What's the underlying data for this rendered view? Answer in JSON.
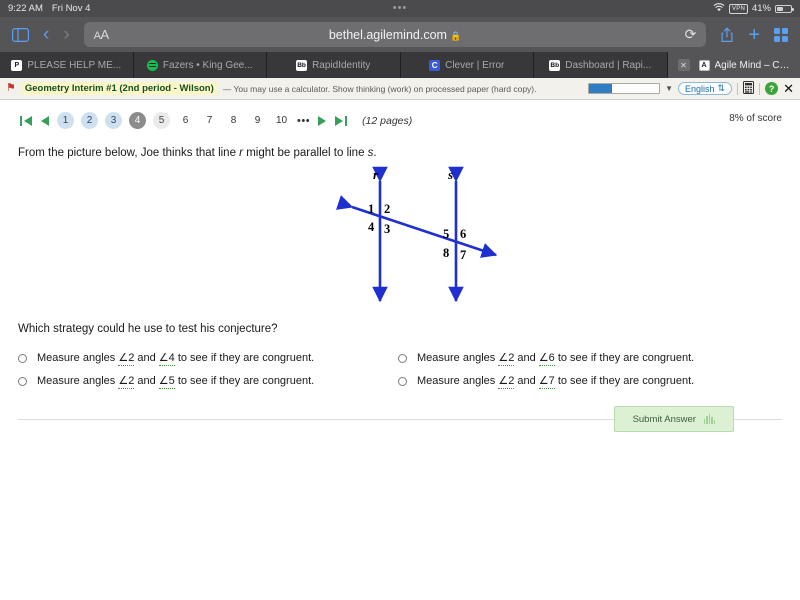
{
  "status_bar": {
    "time": "9:22 AM",
    "date": "Fri Nov 4",
    "dots": "•••",
    "wifi_icon": "wifi-icon",
    "vpn_label": "VPN",
    "battery_percent": "41%"
  },
  "browser": {
    "sidebar_icon": "sidebar-icon",
    "back_icon": "chevron-left-icon",
    "forward_icon": "chevron-right-icon",
    "text_size_label": "AA",
    "url": "bethel.agilemind.com",
    "lock_icon": "lock-icon",
    "reload_icon": "reload-icon",
    "share_icon": "share-icon",
    "new_tab_icon": "plus-icon",
    "show_tabs_icon": "tabs-grid-icon",
    "tabs": [
      {
        "title": "PLEASE HELP ME...",
        "favicon": "powerpoint-icon",
        "favicon_letter": "P",
        "active": false
      },
      {
        "title": "Fazers • King Gee...",
        "favicon": "spotify-icon",
        "favicon_letter": "",
        "active": false
      },
      {
        "title": "RapidIdentity",
        "favicon": "blackboard-icon",
        "favicon_letter": "Bb",
        "active": false
      },
      {
        "title": "Clever | Error",
        "favicon": "clever-icon",
        "favicon_letter": "C",
        "active": false
      },
      {
        "title": "Dashboard | Rapi...",
        "favicon": "blackboard-icon",
        "favicon_letter": "Bb",
        "active": false
      },
      {
        "title": "Agile Mind – Cour...",
        "favicon": "agilemind-icon",
        "favicon_letter": "A",
        "active": true,
        "close_label": "✕"
      }
    ]
  },
  "app_header": {
    "flag_icon": "flag-icon",
    "assignment_title": "Geometry Interim #1 (2nd period - Wilson)",
    "assignment_note": "— You may use a calculator. Show thinking (work) on processed paper (hard copy).",
    "progress_percent": 33,
    "progress_caret_icon": "chevron-down-icon",
    "language": "English",
    "language_caret_icon": "select-chevron-icon",
    "calculator_icon": "calculator-icon",
    "help_icon": "help-icon",
    "help_label": "?",
    "close_icon": "close-icon"
  },
  "pager": {
    "first_icon": "first-page-icon",
    "prev_icon": "previous-page-icon",
    "pages": [
      {
        "label": "1",
        "state": "visited"
      },
      {
        "label": "2",
        "state": "visited"
      },
      {
        "label": "3",
        "state": "visited"
      },
      {
        "label": "4",
        "state": "current"
      },
      {
        "label": "5",
        "state": "next"
      },
      {
        "label": "6",
        "state": "plain"
      },
      {
        "label": "7",
        "state": "plain"
      },
      {
        "label": "8",
        "state": "plain"
      },
      {
        "label": "9",
        "state": "plain"
      },
      {
        "label": "10",
        "state": "plain"
      }
    ],
    "ellipsis": "•••",
    "next_icon": "next-page-icon",
    "last_icon": "last-page-icon",
    "page_count": "(12 pages)",
    "score_text": "8% of score"
  },
  "question": {
    "stem_part1": "From the picture below, Joe thinks that line ",
    "stem_line_r": "r",
    "stem_part2": " might be parallel to line ",
    "stem_line_s": "s",
    "stem_part3": ".",
    "prompt": "Which strategy could he use to test his conjecture?",
    "figure": {
      "line_r_label": "r",
      "line_s_label": "s",
      "angle_labels": [
        "1",
        "2",
        "3",
        "4",
        "5",
        "6",
        "7",
        "8"
      ],
      "line_color": "#1f2fd0"
    },
    "options": [
      {
        "prefix": "Measure angles ",
        "angle_a": "∠2",
        "middle": " and ",
        "angle_b": "∠4",
        "suffix": " to see if they are congruent.",
        "selected": false
      },
      {
        "prefix": "Measure angles ",
        "angle_a": "∠2",
        "middle": " and ",
        "angle_b": "∠6",
        "suffix": " to see if they are congruent.",
        "selected": false
      },
      {
        "prefix": "Measure angles ",
        "angle_a": "∠2",
        "middle": " and ",
        "angle_b": "∠5",
        "suffix": " to see if they are congruent.",
        "selected": false
      },
      {
        "prefix": "Measure angles ",
        "angle_a": "∠2",
        "middle": " and ",
        "angle_b": "∠7",
        "suffix": " to see if they are congruent.",
        "selected": false
      }
    ]
  },
  "submit": {
    "label": "Submit Answer",
    "audio_icon": "audio-icon"
  },
  "colors": {
    "diagram_blue": "#1f2fd0",
    "accent_green": "#36a05a",
    "submit_bg": "#dcf0d4",
    "highlight_yellow": "#fbf6c8"
  }
}
